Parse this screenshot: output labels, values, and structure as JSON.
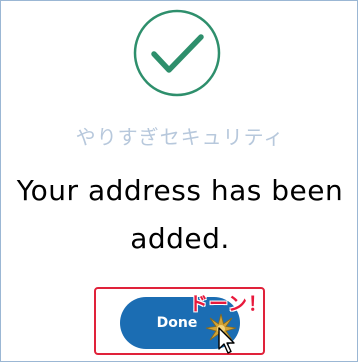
{
  "dialog": {
    "watermark": "やりすぎセキュリティ",
    "message_line1": "Your address has been",
    "message_line2": "added.",
    "done_label": "Done"
  },
  "annotation": {
    "text": "ドーン！"
  },
  "icons": {
    "success": "checkmark-circle-icon",
    "burst": "sparkle-burst-icon",
    "cursor": "mouse-pointer-icon"
  },
  "colors": {
    "check_green": "#2e8f6c",
    "button_blue": "#1b6db3",
    "highlight_red": "#e0223a",
    "annotation_red": "#e8193c",
    "burst_gold": "#d2a437"
  }
}
